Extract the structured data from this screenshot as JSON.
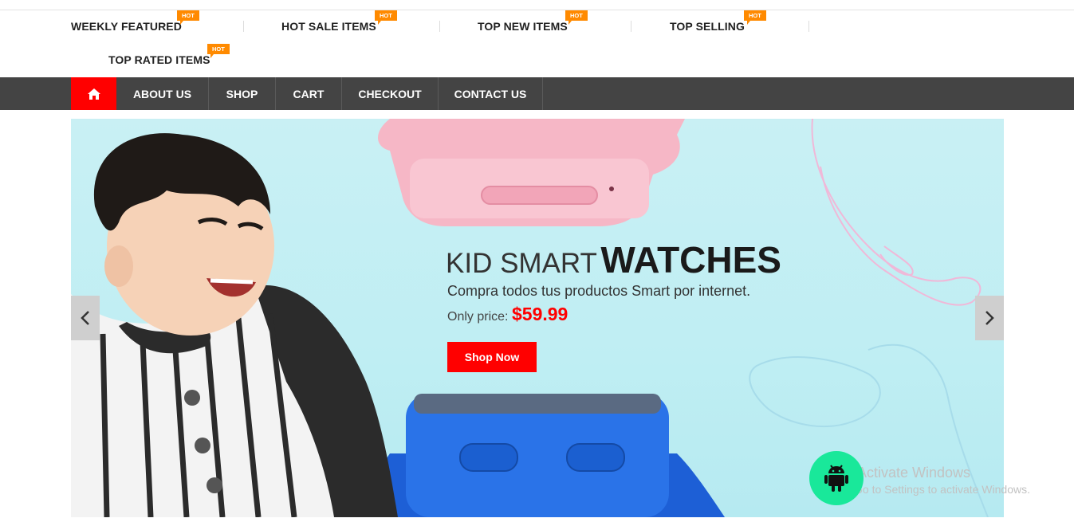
{
  "featured": [
    {
      "label": "WEEKLY FEATURED",
      "badge": "HOT"
    },
    {
      "label": "HOT SALE ITEMS",
      "badge": "HOT"
    },
    {
      "label": "TOP NEW ITEMS",
      "badge": "HOT"
    },
    {
      "label": "TOP SELLING",
      "badge": "HOT"
    },
    {
      "label": "TOP RATED ITEMS",
      "badge": "HOT"
    }
  ],
  "nav": {
    "home_icon": "home-icon",
    "items": [
      "ABOUT US",
      "SHOP",
      "CART",
      "CHECKOUT",
      "CONTACT US"
    ]
  },
  "hero": {
    "title_light": "KID SMART",
    "title_bold": "WATCHES",
    "subtitle": "Compra todos tus productos Smart por internet.",
    "price_label": "Only price:",
    "price": "$59.99",
    "cta": "Shop Now",
    "prev_icon": "chevron-left-icon",
    "next_icon": "chevron-right-icon"
  },
  "overlay": {
    "fab_icon": "android-icon",
    "activate_title": "Activate Windows",
    "activate_sub": "Go to Settings to activate Windows."
  },
  "colors": {
    "accent": "#ff0000",
    "badge": "#ff8a00",
    "navbar": "#444444",
    "fab": "#19e89a"
  }
}
